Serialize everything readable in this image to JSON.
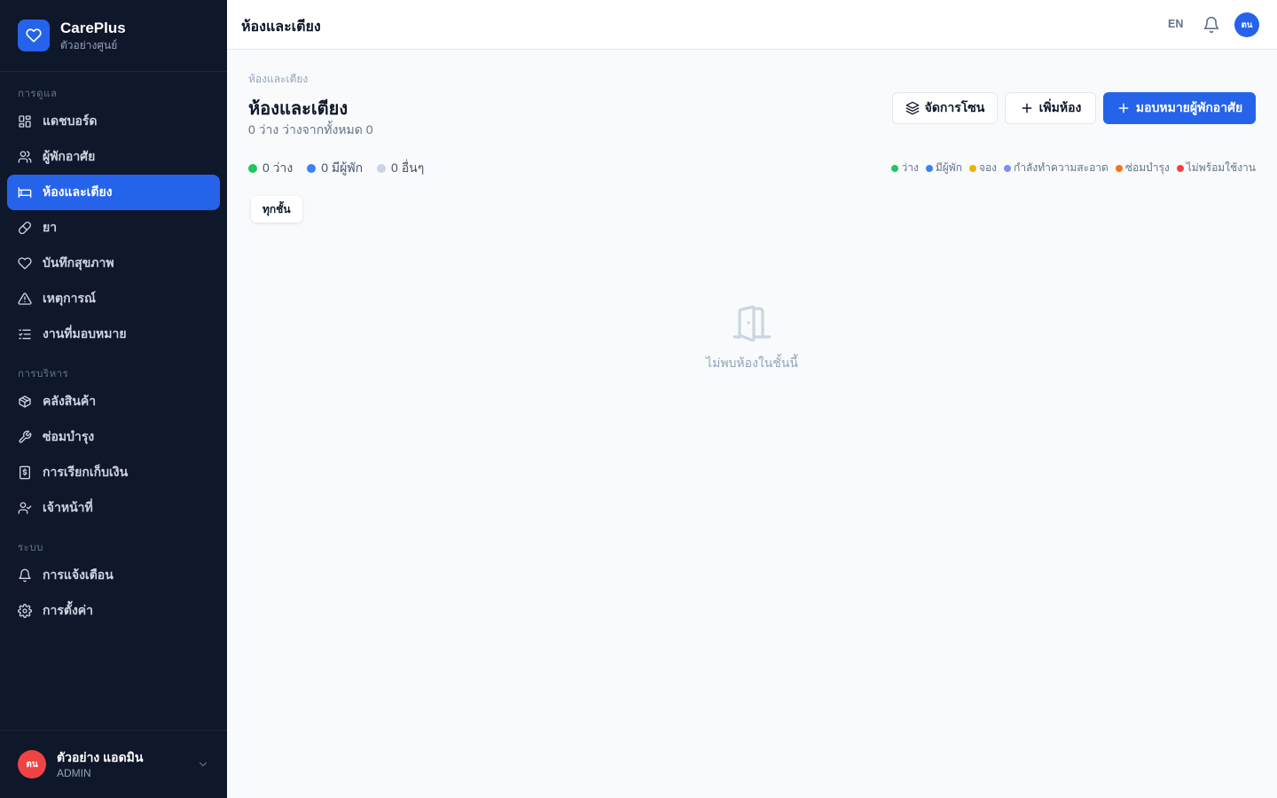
{
  "brand": {
    "name": "CarePlus",
    "subtitle": "ตัวอย่างศูนย์"
  },
  "sidebar": {
    "sections": [
      {
        "label": "การดูแล"
      },
      {
        "label": "การบริหาร"
      },
      {
        "label": "ระบบ"
      }
    ],
    "items": [
      {
        "label": "แดชบอร์ด",
        "icon": "dashboard-icon"
      },
      {
        "label": "ผู้พักอาศัย",
        "icon": "users-icon"
      },
      {
        "label": "ห้องและเตียง",
        "icon": "bed-icon",
        "active": true
      },
      {
        "label": "ยา",
        "icon": "pill-icon"
      },
      {
        "label": "บันทึกสุขภาพ",
        "icon": "heart-icon"
      },
      {
        "label": "เหตุการณ์",
        "icon": "warning-icon"
      },
      {
        "label": "งานที่มอบหมาย",
        "icon": "tasks-icon"
      },
      {
        "label": "คลังสินค้า",
        "icon": "package-icon"
      },
      {
        "label": "ซ่อมบำรุง",
        "icon": "wrench-icon"
      },
      {
        "label": "การเรียกเก็บเงิน",
        "icon": "billing-icon"
      },
      {
        "label": "เจ้าหน้าที่",
        "icon": "staff-icon"
      },
      {
        "label": "การแจ้งเตือน",
        "icon": "bell-icon"
      },
      {
        "label": "การตั้งค่า",
        "icon": "gear-icon"
      }
    ]
  },
  "user": {
    "initials": "ตน",
    "name": "ตัวอย่าง แอดมิน",
    "role": "ADMIN"
  },
  "header": {
    "title": "ห้องและเตียง",
    "lang": "EN",
    "avatar_initials": "ตน"
  },
  "main": {
    "breadcrumb": "ห้องและเตียง",
    "title": "ห้องและเตียง",
    "subtitle": "0 ว่าง ว่างจากทั้งหมด 0",
    "buttons": {
      "zones": "จัดการโซน",
      "add_room": "เพิ่มห้อง",
      "assign": "มอบหมายผู้พักอาศัย"
    },
    "stats": [
      {
        "label": "0 ว่าง",
        "color": "#22c55e"
      },
      {
        "label": "0 มีผู้พัก",
        "color": "#3b82f6"
      },
      {
        "label": "0 อื่นๆ",
        "color": "#cbd5e1"
      }
    ],
    "legend": [
      {
        "label": "ว่าง",
        "color": "#22c55e"
      },
      {
        "label": "มีผู้พัก",
        "color": "#3b82f6"
      },
      {
        "label": "จอง",
        "color": "#eab308"
      },
      {
        "label": "กำลังทำความสะอาด",
        "color": "#818cf8"
      },
      {
        "label": "ซ่อมบำรุง",
        "color": "#f97316"
      },
      {
        "label": "ไม่พร้อมใช้งาน",
        "color": "#ef4444"
      }
    ],
    "floor_filter": "ทุกชั้น",
    "empty_text": "ไม่พบห้องในชั้นนี้"
  }
}
